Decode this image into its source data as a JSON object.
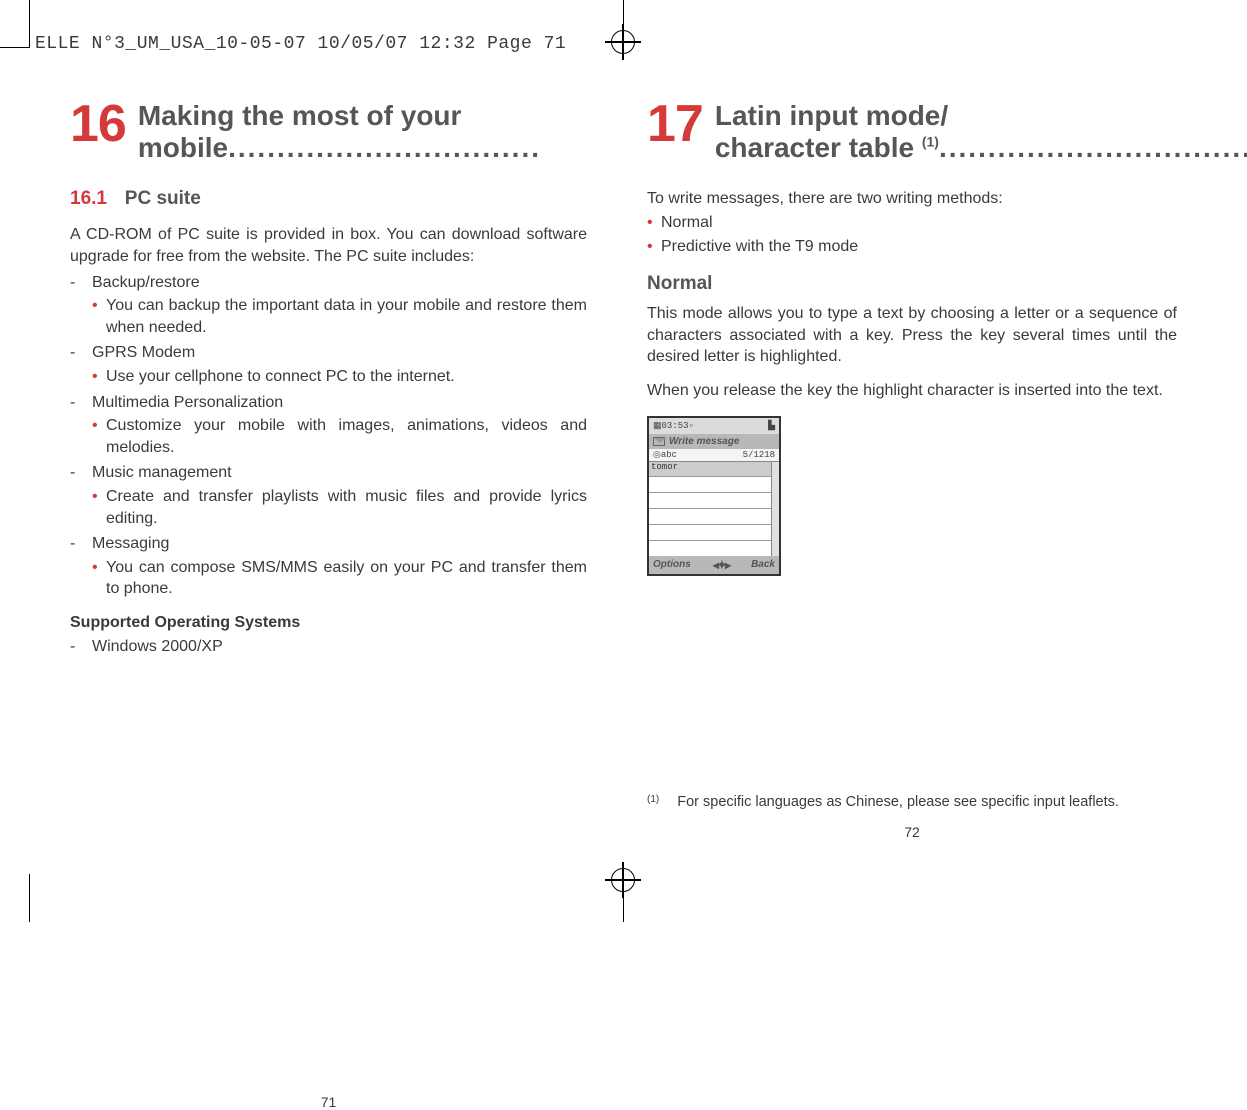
{
  "header_meta": "ELLE N°3_UM_USA_10-05-07  10/05/07  12:32  Page 71",
  "left": {
    "chapter_num": "16",
    "chapter_title_line1": "Making the most of your",
    "chapter_title_line2": "mobile",
    "section_num": "16.1",
    "section_title": "PC suite",
    "intro": "A CD-ROM of PC suite is provided in box. You can download software upgrade for free from the website. The PC suite includes:",
    "items": [
      {
        "head": "Backup/restore",
        "sub": "You can backup the important data in your mobile and restore them when needed."
      },
      {
        "head": "GPRS Modem",
        "sub": "Use your cellphone to connect PC to the internet."
      },
      {
        "head": "Multimedia Personalization",
        "sub": "Customize your mobile with images, animations, videos and melodies."
      },
      {
        "head": "Music management",
        "sub": "Create and transfer playlists with music files and provide lyrics editing."
      },
      {
        "head": "Messaging",
        "sub": "You can compose SMS/MMS easily on your PC and transfer them to phone."
      }
    ],
    "supported_heading": "Supported Operating Systems",
    "supported_item": "Windows 2000/XP",
    "page_num": "71"
  },
  "right": {
    "chapter_num": "17",
    "chapter_title_line1": "Latin input mode/",
    "chapter_title_line2a": "character table",
    "chapter_title_line2_sup": "(1)",
    "intro": "To write messages, there are two writing methods:",
    "bullets": [
      "Normal",
      "Predictive with the T9 mode"
    ],
    "subhead": "Normal",
    "para1": "This mode allows you to type a text by choosing a letter or a sequence of characters associated with a key. Press the key several times until the desired letter is highlighted.",
    "para2": "When you release the key the highlight character is inserted into the text.",
    "phone": {
      "time": "03:53",
      "title": "Write message",
      "sub_left": "abc",
      "sub_right": "5/1218",
      "typed": "tomor",
      "soft_left": "Options",
      "soft_right": "Back"
    },
    "footnote_num": "(1)",
    "footnote_text": "For specific languages as Chinese, please see specific input leaflets.",
    "page_num": "72"
  },
  "dots": "................................"
}
